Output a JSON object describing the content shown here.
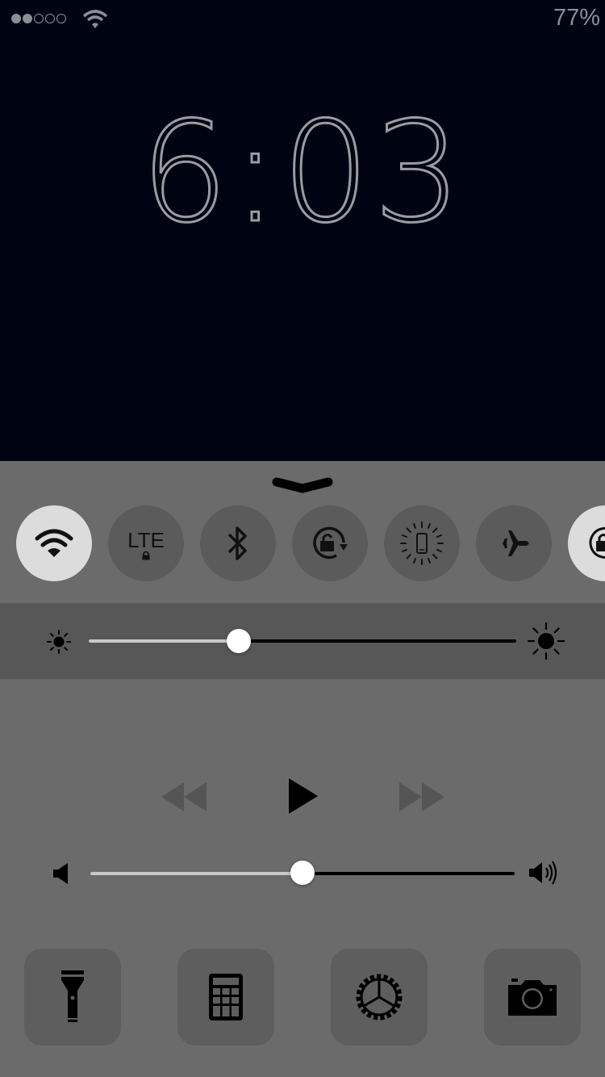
{
  "status_bar": {
    "signal_strength_bars": 2,
    "signal_total_bars": 5,
    "wifi_icon": "wifi-icon",
    "battery": "77%"
  },
  "lock_screen": {
    "time": "6:03"
  },
  "control_center": {
    "toggles": [
      {
        "name": "wifi",
        "icon": "wifi-icon",
        "state": "on"
      },
      {
        "name": "lte",
        "label": "LTE",
        "icon": "lte-lock-icon",
        "state": "off"
      },
      {
        "name": "bluetooth",
        "icon": "bluetooth-icon",
        "state": "off"
      },
      {
        "name": "rotation-lock",
        "icon": "rotation-lock-icon",
        "state": "off"
      },
      {
        "name": "vibrate",
        "icon": "vibrate-icon",
        "state": "off"
      },
      {
        "name": "airplane",
        "icon": "airplane-icon",
        "state": "off"
      },
      {
        "name": "orientation-lock",
        "icon": "lock-icon",
        "state": "on"
      }
    ],
    "brightness": {
      "level": 0.35
    },
    "media": {
      "controls": [
        "rewind-icon",
        "play-icon",
        "fast-forward-icon"
      ]
    },
    "volume": {
      "level": 0.5
    },
    "tools": [
      "flashlight-icon",
      "calculator-icon",
      "settings-icon",
      "camera-icon"
    ],
    "colors": {
      "background": "#6b6b6b",
      "toggle_off": "#5b5b5b",
      "toggle_on": "#dcdcdc",
      "band": "#575757"
    }
  }
}
